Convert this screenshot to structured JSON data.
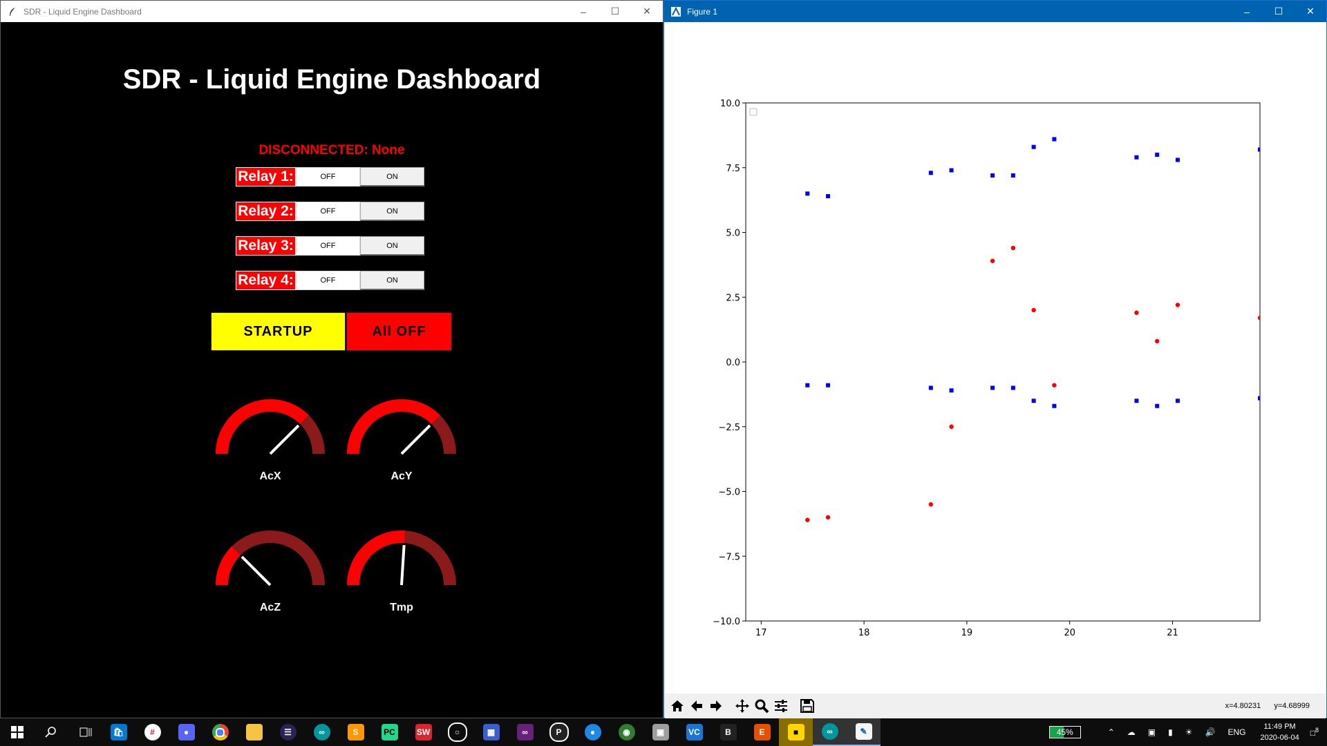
{
  "left_window": {
    "title": "SDR - Liquid Engine Dashboard",
    "dashboard_title": "SDR - Liquid Engine Dashboard",
    "status": "DISCONNECTED: None",
    "relays": [
      {
        "label": "Relay 1:",
        "off": "OFF",
        "on": "ON"
      },
      {
        "label": "Relay 2:",
        "off": "OFF",
        "on": "ON"
      },
      {
        "label": "Relay 3:",
        "off": "OFF",
        "on": "ON"
      },
      {
        "label": "Relay 4:",
        "off": "OFF",
        "on": "ON"
      }
    ],
    "startup_label": "STARTUP",
    "alloff_label": "All OFF",
    "gauges": [
      {
        "label": "AcX",
        "value_fraction": 0.75
      },
      {
        "label": "AcY",
        "value_fraction": 0.75
      },
      {
        "label": "AcZ",
        "value_fraction": 0.25
      },
      {
        "label": "Tmp",
        "value_fraction": 0.52
      }
    ],
    "colors": {
      "relay_label": "#ff0000",
      "startup": "#ffff00",
      "alloff": "#ff0000",
      "gauge_fill": "#ff0000",
      "gauge_track": "#8b1a1a"
    }
  },
  "right_window": {
    "title": "Figure 1",
    "toolbar": [
      "home-icon",
      "back-icon",
      "forward-icon",
      "pan-icon",
      "zoom-icon",
      "configure-icon",
      "save-icon"
    ],
    "coords": {
      "x": "x=4.80231",
      "y": "y=4.68999"
    }
  },
  "chart_data": {
    "type": "scatter",
    "xlim": [
      16.85,
      21.85
    ],
    "ylim": [
      -10.0,
      10.0
    ],
    "xticks": [
      "17",
      "18",
      "19",
      "20",
      "21"
    ],
    "xtick_values": [
      17,
      18,
      19,
      20,
      21
    ],
    "yticks": [
      "10.0",
      "7.5",
      "5.0",
      "2.5",
      "0.0",
      "−2.5",
      "−5.0",
      "−7.5",
      "−10.0"
    ],
    "ytick_values": [
      10.0,
      7.5,
      5.0,
      2.5,
      0.0,
      -2.5,
      -5.0,
      -7.5,
      -10.0
    ],
    "grid": false,
    "series": [
      {
        "marker": "square",
        "color": "#0000ff",
        "x": [
          17.45,
          17.65,
          18.65,
          18.85,
          19.25,
          19.45,
          19.65,
          19.85,
          20.65,
          20.85,
          21.05,
          21.85
        ],
        "y": [
          6.5,
          6.4,
          7.3,
          7.4,
          7.2,
          7.2,
          8.3,
          8.6,
          7.9,
          8.0,
          7.8,
          8.2
        ]
      },
      {
        "marker": "square",
        "color": "#0000ff",
        "x": [
          17.45,
          17.65,
          18.65,
          18.85,
          19.25,
          19.45,
          19.65,
          19.85,
          20.65,
          20.85,
          21.05,
          21.85
        ],
        "y": [
          -0.9,
          -0.9,
          -1.0,
          -1.1,
          -1.0,
          -1.0,
          -1.5,
          -1.7,
          -1.5,
          -1.7,
          -1.5,
          -1.4
        ]
      },
      {
        "marker": "circle",
        "color": "#ff0000",
        "x": [
          17.45,
          17.65,
          18.65,
          18.85,
          19.25,
          19.45,
          19.65,
          19.85,
          20.65,
          20.85,
          21.05,
          21.85
        ],
        "y": [
          -6.1,
          -6.0,
          -5.5,
          -2.5,
          3.9,
          4.4,
          2.0,
          -0.9,
          1.9,
          0.8,
          2.2,
          1.7
        ]
      }
    ]
  },
  "taskbar": {
    "apps": [
      "windows-start-icon",
      "search-icon",
      "task-view-icon",
      "store-icon",
      "slack-icon",
      "discord-icon",
      "chrome-icon",
      "file-explorer-icon",
      "eclipse-icon",
      "arduino-icon",
      "sublime-icon",
      "pycharm-icon",
      "solidworks-icon",
      "app-circle-icon",
      "network-app-icon",
      "visual-studio-icon",
      "p-app-icon",
      "app-globe-icon",
      "app-map-icon",
      "printer-icon",
      "vc-icon",
      "b-app-icon",
      "e-app-icon",
      "sticky-notes-icon",
      "arduino-icon-2",
      "python-figure-icon"
    ],
    "battery": "45%",
    "battery_fraction": 0.45,
    "lang": "ENG",
    "time": "11:49 PM",
    "date": "2020-06-04",
    "notifications": "8"
  }
}
